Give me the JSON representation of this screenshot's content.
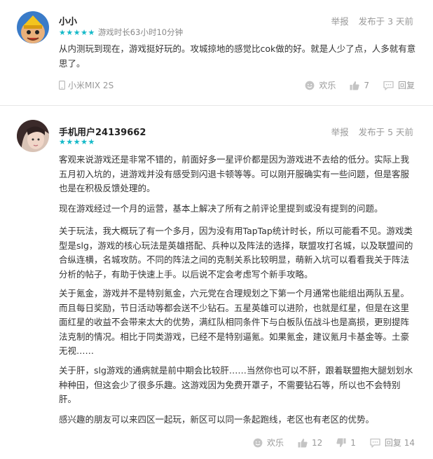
{
  "reviews": [
    {
      "user": "小小",
      "stars": "★★★★★",
      "playtime": "游戏时长63小时10分钟",
      "report": "举报",
      "posted": "发布于 3 天前",
      "paragraphs": [
        "从内测玩到现在，游戏挺好玩的。攻城掠地的感觉比cok做的好。就是人少了点，人多就有意思了。"
      ],
      "device": "小米MIX 2S",
      "funny": "欢乐",
      "likes": "7",
      "reply": "回复"
    },
    {
      "user": "手机用户24139662",
      "stars": "★★★★★",
      "report": "举报",
      "posted": "发布于 5 天前",
      "paragraphs": [
        "客观来说游戏还是非常不错的，前面好多一星评价都是因为游戏进不去给的低分。实际上我五月初入坑的，进游戏并没有感受到闪退卡顿等等。可以刚开服确实有一些问题，但是客服也是在积极反馈处理的。",
        "现在游戏经过一个月的运营，基本上解决了所有之前评论里提到或没有提到的问题。",
        "关于玩法，我大概玩了有一个多月，因为没有用TapTap统计时长，所以可能看不见。游戏类型是slg，游戏的核心玩法是英雄搭配、兵种以及阵法的选择，联盟攻打名城，以及联盟间的合纵连横，名城攻防。不同的阵法之间的克制关系比较明显，萌新入坑可以看看我关于阵法分析的帖子，有助于快速上手。以后说不定会考虑写个新手攻略。",
        "关于氪金，游戏并不是特别氪金，六元党在合理规划之下第一个月通常也能组出两队五星。而且每日奖励，节日活动等都会送不少钻石。五星英雄可以进阶，也就是红星，但是在这里面红星的收益不会带来太大的优势，满红队相同条件下与白板队伍战斗也是高损，更别提阵法克制的情况。相比于同类游戏，已经不是特别逼氪。如果氪金，建议氪月卡基金等。土豪无视……",
        "关于肝，slg游戏的通病就是前中期会比较肝……当然你也可以不肝，跟着联盟抱大腿划划水种种田，但这会少了很多乐趣。这游戏因为免费开罩子，不需要钻石等，所以也不会特别肝。",
        "感兴趣的朋友可以来四区一起玩，新区可以同一条起跑线，老区也有老区的优势。"
      ],
      "funny": "欢乐",
      "likes": "12",
      "dislikes": "1",
      "reply": "回复 14"
    }
  ],
  "colors": {
    "accent": "#14b9c8",
    "muted": "#999999",
    "text": "#333333"
  },
  "icons": [
    "smile-icon",
    "thumb-up-icon",
    "thumb-down-icon",
    "reply-icon",
    "phone-icon"
  ]
}
